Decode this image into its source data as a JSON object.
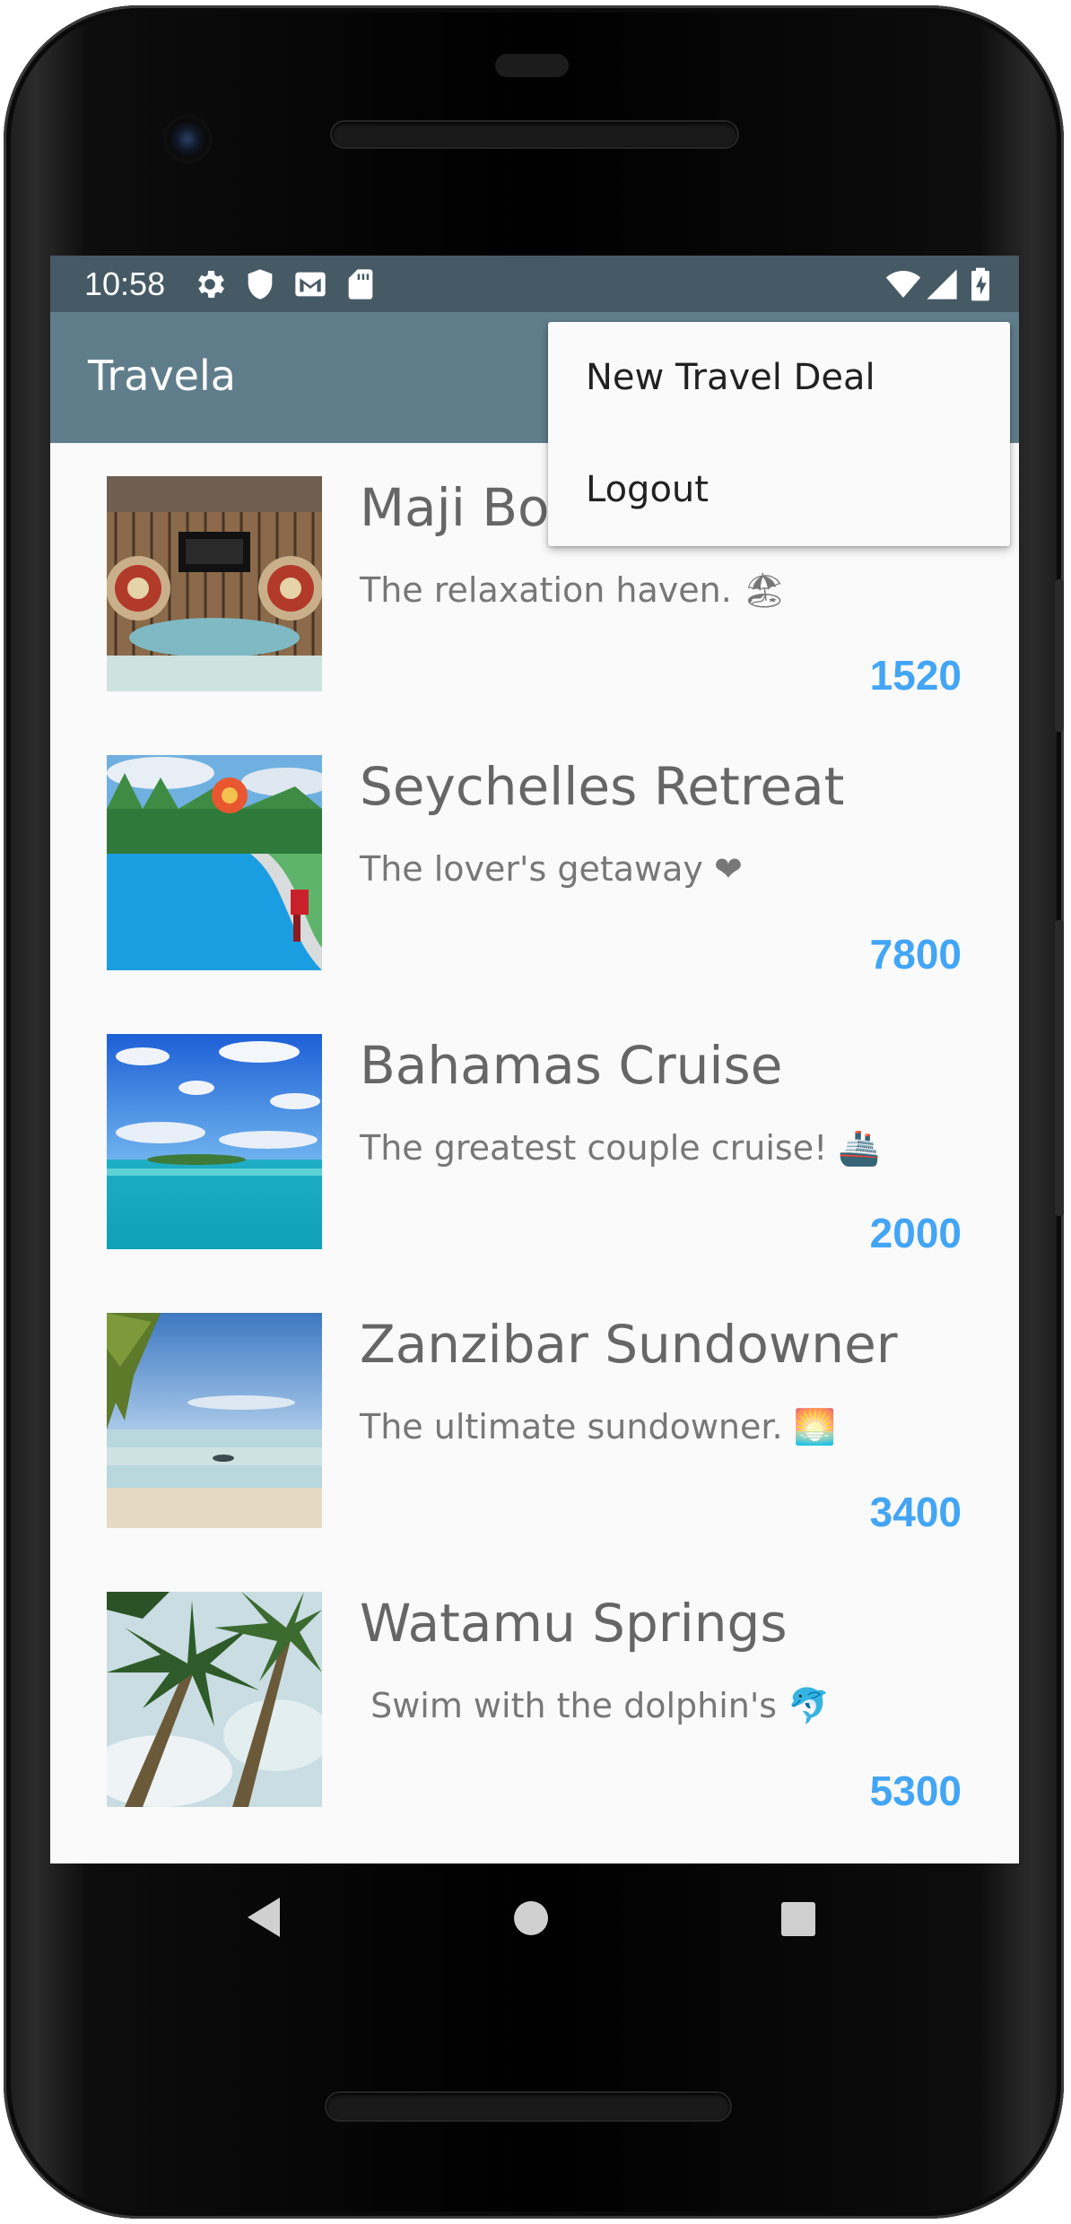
{
  "status_bar": {
    "time": "10:58",
    "left_icons": [
      "gear-icon",
      "shield-icon",
      "gmail-icon",
      "sd-card-icon"
    ],
    "right_icons": [
      "wifi-icon",
      "cell-signal-icon",
      "battery-charging-icon"
    ]
  },
  "app_bar": {
    "title": "Travela"
  },
  "menu": {
    "items": [
      {
        "label": "New Travel Deal"
      },
      {
        "label": "Logout"
      }
    ]
  },
  "deals": [
    {
      "title": "Maji Bo",
      "description": "The relaxation haven. 🏖",
      "price": "1520"
    },
    {
      "title": "Seychelles Retreat",
      "description": "The lover's getaway ❤",
      "price": "7800"
    },
    {
      "title": "Bahamas Cruise",
      "description": "The greatest couple cruise! 🚢",
      "price": "2000"
    },
    {
      "title": "Zanzibar Sundowner",
      "description": "The ultimate sundowner. 🌅",
      "price": "3400"
    },
    {
      "title": "Watamu Springs",
      "description": " Swim with the dolphin's 🐬",
      "price": "5300"
    }
  ],
  "nav_bar": {
    "buttons": [
      "back-icon",
      "home-icon",
      "recents-icon"
    ]
  },
  "colors": {
    "status_bar": "#455a64",
    "app_bar": "#607d8b",
    "price": "#42a5f5",
    "background": "#fafafa"
  }
}
